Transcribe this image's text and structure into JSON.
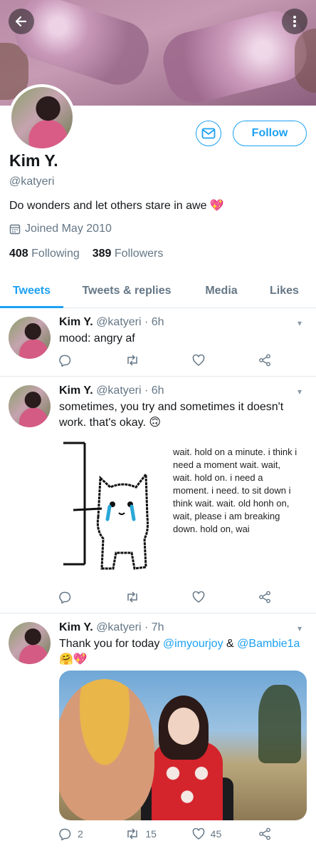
{
  "profile": {
    "name": "Kim Y.",
    "handle": "@katyeri",
    "bio": "Do wonders and let others stare in awe 💖",
    "joined": "Joined May 2010",
    "following_count": "408",
    "following_label": "Following",
    "followers_count": "389",
    "followers_label": "Followers",
    "follow_label": "Follow"
  },
  "tabs": [
    {
      "label": "Tweets",
      "active": true
    },
    {
      "label": "Tweets & replies",
      "active": false
    },
    {
      "label": "Media",
      "active": false
    },
    {
      "label": "Likes",
      "active": false
    }
  ],
  "tweets": [
    {
      "name": "Kim Y.",
      "meta": "@katyeri · 6h",
      "text": "mood: angry af",
      "replies": "",
      "retweets": "",
      "likes": ""
    },
    {
      "name": "Kim Y.",
      "meta": "@katyeri · 6h",
      "text": "sometimes, you try and sometimes it doesn't work. that's okay. 🙃",
      "meme_text": "wait. hold on a minute. i think i need a moment wait. wait, wait. hold on. i need a moment. i need. to sit down i think wait. wait. old honh on, wait, please i am breaking down. hold on, wai",
      "replies": "",
      "retweets": "",
      "likes": ""
    },
    {
      "name": "Kim Y.",
      "meta": "@katyeri · 7h",
      "text_prefix": "Thank you for today",
      "mention1": "@imyourjoy",
      "text_mid": "&",
      "mention2": "@Bambie1a",
      "text_suffix": "🤗💖",
      "replies": "2",
      "retweets": "15",
      "likes": "45"
    }
  ],
  "colors": {
    "accent": "#1da1f2",
    "muted": "#657786",
    "text": "#14171a"
  }
}
